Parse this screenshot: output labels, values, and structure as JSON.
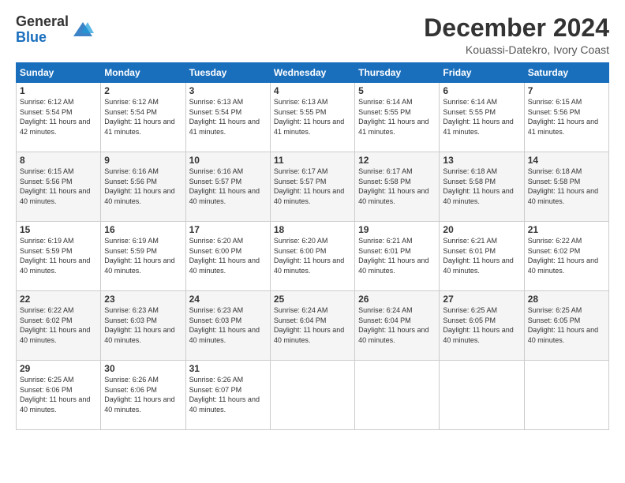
{
  "app": {
    "logo_general": "General",
    "logo_blue": "Blue"
  },
  "header": {
    "month_year": "December 2024",
    "location": "Kouassi-Datekro, Ivory Coast"
  },
  "calendar": {
    "days_of_week": [
      "Sunday",
      "Monday",
      "Tuesday",
      "Wednesday",
      "Thursday",
      "Friday",
      "Saturday"
    ],
    "weeks": [
      [
        {
          "day": "1",
          "sunrise": "6:12 AM",
          "sunset": "5:54 PM",
          "daylight": "11 hours and 42 minutes."
        },
        {
          "day": "2",
          "sunrise": "6:12 AM",
          "sunset": "5:54 PM",
          "daylight": "11 hours and 41 minutes."
        },
        {
          "day": "3",
          "sunrise": "6:13 AM",
          "sunset": "5:54 PM",
          "daylight": "11 hours and 41 minutes."
        },
        {
          "day": "4",
          "sunrise": "6:13 AM",
          "sunset": "5:55 PM",
          "daylight": "11 hours and 41 minutes."
        },
        {
          "day": "5",
          "sunrise": "6:14 AM",
          "sunset": "5:55 PM",
          "daylight": "11 hours and 41 minutes."
        },
        {
          "day": "6",
          "sunrise": "6:14 AM",
          "sunset": "5:55 PM",
          "daylight": "11 hours and 41 minutes."
        },
        {
          "day": "7",
          "sunrise": "6:15 AM",
          "sunset": "5:56 PM",
          "daylight": "11 hours and 41 minutes."
        }
      ],
      [
        {
          "day": "8",
          "sunrise": "6:15 AM",
          "sunset": "5:56 PM",
          "daylight": "11 hours and 40 minutes."
        },
        {
          "day": "9",
          "sunrise": "6:16 AM",
          "sunset": "5:56 PM",
          "daylight": "11 hours and 40 minutes."
        },
        {
          "day": "10",
          "sunrise": "6:16 AM",
          "sunset": "5:57 PM",
          "daylight": "11 hours and 40 minutes."
        },
        {
          "day": "11",
          "sunrise": "6:17 AM",
          "sunset": "5:57 PM",
          "daylight": "11 hours and 40 minutes."
        },
        {
          "day": "12",
          "sunrise": "6:17 AM",
          "sunset": "5:58 PM",
          "daylight": "11 hours and 40 minutes."
        },
        {
          "day": "13",
          "sunrise": "6:18 AM",
          "sunset": "5:58 PM",
          "daylight": "11 hours and 40 minutes."
        },
        {
          "day": "14",
          "sunrise": "6:18 AM",
          "sunset": "5:58 PM",
          "daylight": "11 hours and 40 minutes."
        }
      ],
      [
        {
          "day": "15",
          "sunrise": "6:19 AM",
          "sunset": "5:59 PM",
          "daylight": "11 hours and 40 minutes."
        },
        {
          "day": "16",
          "sunrise": "6:19 AM",
          "sunset": "5:59 PM",
          "daylight": "11 hours and 40 minutes."
        },
        {
          "day": "17",
          "sunrise": "6:20 AM",
          "sunset": "6:00 PM",
          "daylight": "11 hours and 40 minutes."
        },
        {
          "day": "18",
          "sunrise": "6:20 AM",
          "sunset": "6:00 PM",
          "daylight": "11 hours and 40 minutes."
        },
        {
          "day": "19",
          "sunrise": "6:21 AM",
          "sunset": "6:01 PM",
          "daylight": "11 hours and 40 minutes."
        },
        {
          "day": "20",
          "sunrise": "6:21 AM",
          "sunset": "6:01 PM",
          "daylight": "11 hours and 40 minutes."
        },
        {
          "day": "21",
          "sunrise": "6:22 AM",
          "sunset": "6:02 PM",
          "daylight": "11 hours and 40 minutes."
        }
      ],
      [
        {
          "day": "22",
          "sunrise": "6:22 AM",
          "sunset": "6:02 PM",
          "daylight": "11 hours and 40 minutes."
        },
        {
          "day": "23",
          "sunrise": "6:23 AM",
          "sunset": "6:03 PM",
          "daylight": "11 hours and 40 minutes."
        },
        {
          "day": "24",
          "sunrise": "6:23 AM",
          "sunset": "6:03 PM",
          "daylight": "11 hours and 40 minutes."
        },
        {
          "day": "25",
          "sunrise": "6:24 AM",
          "sunset": "6:04 PM",
          "daylight": "11 hours and 40 minutes."
        },
        {
          "day": "26",
          "sunrise": "6:24 AM",
          "sunset": "6:04 PM",
          "daylight": "11 hours and 40 minutes."
        },
        {
          "day": "27",
          "sunrise": "6:25 AM",
          "sunset": "6:05 PM",
          "daylight": "11 hours and 40 minutes."
        },
        {
          "day": "28",
          "sunrise": "6:25 AM",
          "sunset": "6:05 PM",
          "daylight": "11 hours and 40 minutes."
        }
      ],
      [
        {
          "day": "29",
          "sunrise": "6:25 AM",
          "sunset": "6:06 PM",
          "daylight": "11 hours and 40 minutes."
        },
        {
          "day": "30",
          "sunrise": "6:26 AM",
          "sunset": "6:06 PM",
          "daylight": "11 hours and 40 minutes."
        },
        {
          "day": "31",
          "sunrise": "6:26 AM",
          "sunset": "6:07 PM",
          "daylight": "11 hours and 40 minutes."
        },
        null,
        null,
        null,
        null
      ]
    ]
  }
}
